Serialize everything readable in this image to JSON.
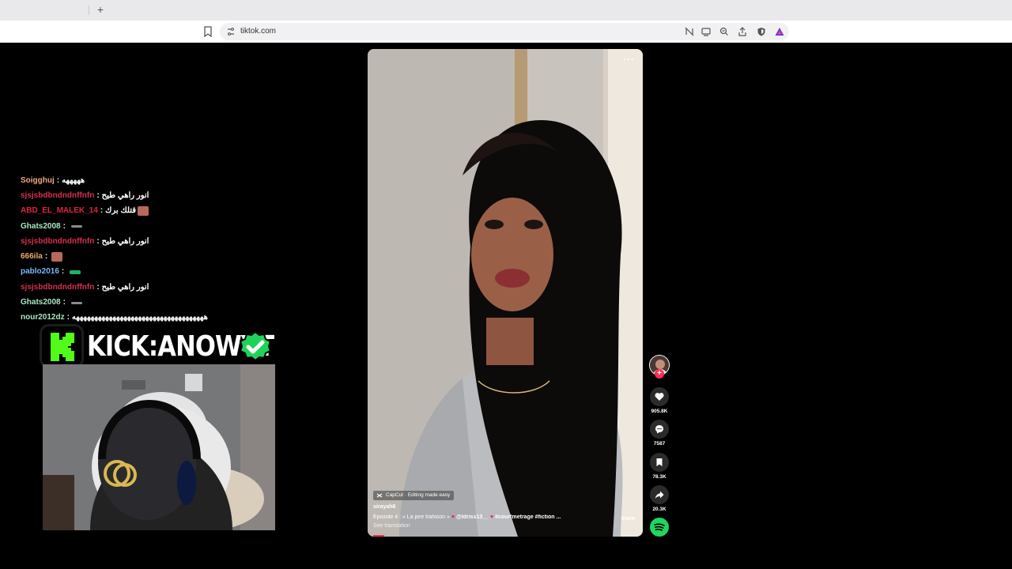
{
  "browser": {
    "url": "tiktok.com",
    "new_tab_glyph": "+"
  },
  "chat": {
    "messages": [
      {
        "user": "Soigghuj",
        "user_color": "#f2a77e",
        "text": "هههههه",
        "emote": null
      },
      {
        "user": "sjsjsbdbndndnffnfn",
        "user_color": "#d4314f",
        "text": "انور راهي طيح",
        "emote": null
      },
      {
        "user": "ABD_EL_MALEK_14",
        "user_color": "#e0263a",
        "text": "قتلك برك",
        "emote": "reaction-emote"
      },
      {
        "user": "Ghats2008",
        "user_color": "#a8e7c0",
        "text": "",
        "emote": "grey-emote"
      },
      {
        "user": "sjsjsbdbndndnffnfn",
        "user_color": "#d4314f",
        "text": "انور راهي طيح",
        "emote": null
      },
      {
        "user": "666ila",
        "user_color": "#f1a86f",
        "text": "",
        "emote": "reaction-emote"
      },
      {
        "user": "pablo2016",
        "user_color": "#7ab8ff",
        "text": "",
        "emote": "green-emote"
      },
      {
        "user": "sjsjsbdbndndnffnfn",
        "user_color": "#d4314f",
        "text": "انور راهي طيح",
        "emote": null
      },
      {
        "user": "Ghats2008",
        "user_color": "#a8e7c0",
        "text": "",
        "emote": "grey-emote"
      },
      {
        "user": "nour2012dz",
        "user_color": "#a8e7c0",
        "text": "ههههههههههههههههههههههههههههههههههههه",
        "emote": null
      }
    ],
    "separator": ":"
  },
  "overlay": {
    "kick_text": "KICK:ANOWYT",
    "kick_color": "#53fc18"
  },
  "video": {
    "menu_glyph": "···",
    "capcut_label": "CapCut · Editing made easy",
    "author": "sirayah6",
    "caption_text": "Épisode 4 : « La pire trahison »",
    "caption_mention": "@ldriss13__",
    "caption_heart": "♥",
    "caption_tags": "#courtmetrage  #fiction  ...",
    "see_translation": "See translation",
    "more_label": "more"
  },
  "actions": {
    "follow_glyph": "+",
    "likes": "905.8K",
    "comments": "7587",
    "saves": "78.3K",
    "shares": "20.3K"
  },
  "colors": {
    "tiktok_red": "#fe2c55",
    "spotify_green": "#1ed760"
  }
}
